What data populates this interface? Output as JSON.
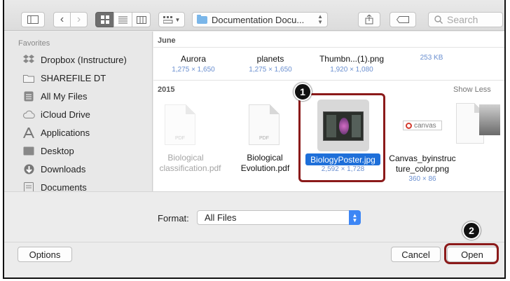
{
  "toolbar": {
    "location": "Documentation Docu...",
    "search_placeholder": "Search"
  },
  "sidebar": {
    "heading": "Favorites",
    "items": [
      {
        "label": "Dropbox (Instructure)",
        "icon": "dropbox-icon"
      },
      {
        "label": "SHAREFILE DT",
        "icon": "folder-icon"
      },
      {
        "label": "All My Files",
        "icon": "all-files-icon"
      },
      {
        "label": "iCloud Drive",
        "icon": "cloud-icon"
      },
      {
        "label": "Applications",
        "icon": "applications-icon"
      },
      {
        "label": "Desktop",
        "icon": "desktop-icon"
      },
      {
        "label": "Downloads",
        "icon": "downloads-icon"
      },
      {
        "label": "Documents",
        "icon": "documents-icon"
      }
    ]
  },
  "june": {
    "header": "June",
    "files": [
      {
        "name": "Aurora",
        "size": "1,275 × 1,650"
      },
      {
        "name": "planets",
        "size": "1,275 × 1,650"
      },
      {
        "name": "Thumbn...(1).png",
        "size": "1,920 × 1,080"
      },
      {
        "name": "",
        "size": "253 KB"
      }
    ]
  },
  "y2015": {
    "header": "2015",
    "show_less": "Show Less",
    "files": [
      {
        "name_line1": "Biological",
        "name_line2": "classification.pdf"
      },
      {
        "name_line1": "Biological",
        "name_line2": "Evolution.pdf"
      },
      {
        "name": "BiologyPoster.jpg",
        "size": "2,592 × 1,728"
      },
      {
        "name_line1": "Canvas_byinstruc",
        "name_line2": "ture_color.png",
        "size": "360 × 86"
      }
    ],
    "doc_label": "PDF",
    "canvas_logo_text": "canvas"
  },
  "format": {
    "label": "Format:",
    "value": "All Files"
  },
  "buttons": {
    "options": "Options",
    "cancel": "Cancel",
    "open": "Open"
  },
  "callouts": {
    "step1": "1",
    "step2": "2"
  },
  "colors": {
    "selection": "#1e6fd9",
    "callout_border": "#8b1a1a",
    "stepper": "#3d86f5"
  }
}
